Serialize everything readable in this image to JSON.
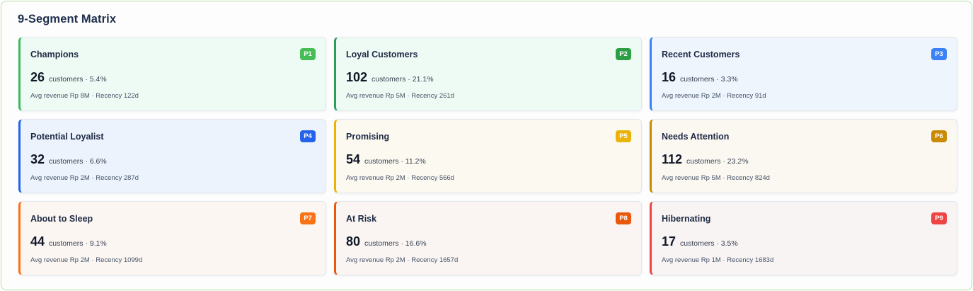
{
  "title": "9-Segment Matrix",
  "segments": [
    {
      "name": "Champions",
      "badge": "P1",
      "count": "26",
      "meta": "customers · 5.4%",
      "detail": "Avg revenue Rp 8M · Recency 122d",
      "accent": "#3cb963",
      "badge_color": "#46be55",
      "bg": "#eefbf5"
    },
    {
      "name": "Loyal Customers",
      "badge": "P2",
      "count": "102",
      "meta": "customers · 21.1%",
      "detail": "Avg revenue Rp 5M · Recency 261d",
      "accent": "#2f9d5a",
      "badge_color": "#2e9e45",
      "bg": "#eefbf5"
    },
    {
      "name": "Recent Customers",
      "badge": "P3",
      "count": "16",
      "meta": "customers · 3.3%",
      "detail": "Avg revenue Rp 2M · Recency 91d",
      "accent": "#3b82f6",
      "badge_color": "#3b82f6",
      "bg": "#eef5fd"
    },
    {
      "name": "Potential Loyalist",
      "badge": "P4",
      "count": "32",
      "meta": "customers · 6.6%",
      "detail": "Avg revenue Rp 2M · Recency 287d",
      "accent": "#2563eb",
      "badge_color": "#2563eb",
      "bg": "#ecf3fd"
    },
    {
      "name": "Promising",
      "badge": "P5",
      "count": "54",
      "meta": "customers · 11.2%",
      "detail": "Avg revenue Rp 2M · Recency 566d",
      "accent": "#eab308",
      "badge_color": "#eab308",
      "bg": "#fcf9f1"
    },
    {
      "name": "Needs Attention",
      "badge": "P6",
      "count": "112",
      "meta": "customers · 23.2%",
      "detail": "Avg revenue Rp 5M · Recency 824d",
      "accent": "#ca8a04",
      "badge_color": "#ca8a04",
      "bg": "#fbf8f2"
    },
    {
      "name": "About to Sleep",
      "badge": "P7",
      "count": "44",
      "meta": "customers · 9.1%",
      "detail": "Avg revenue Rp 2M · Recency 1099d",
      "accent": "#f97316",
      "badge_color": "#f97316",
      "bg": "#fbf6f2"
    },
    {
      "name": "At Risk",
      "badge": "P8",
      "count": "80",
      "meta": "customers · 16.6%",
      "detail": "Avg revenue Rp 2M · Recency 1657d",
      "accent": "#ea580c",
      "badge_color": "#ea580c",
      "bg": "#faf5f2"
    },
    {
      "name": "Hibernating",
      "badge": "P9",
      "count": "17",
      "meta": "customers · 3.5%",
      "detail": "Avg revenue Rp 1M · Recency 1683d",
      "accent": "#ef4444",
      "badge_color": "#ef4444",
      "bg": "#f8f4f3"
    }
  ]
}
